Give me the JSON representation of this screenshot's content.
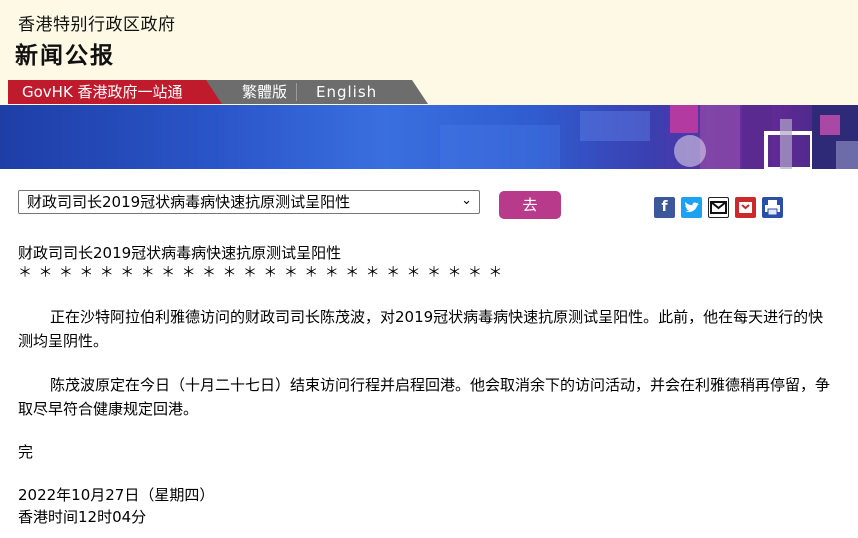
{
  "header": {
    "org": "香港特别行政区政府",
    "title": "新闻公报"
  },
  "nav": {
    "govhk": "GovHK 香港政府一站通",
    "traditional": "繁體版",
    "english": "English"
  },
  "controls": {
    "selected_news": "财政司司长2019冠状病毒病快速抗原测试呈阳性",
    "go_label": "去"
  },
  "share_icons": [
    "facebook-icon",
    "twitter-icon",
    "email-icon",
    "bookmark-icon",
    "print-icon"
  ],
  "article": {
    "title": "财政司司长2019冠状病毒病快速抗原测试呈阳性",
    "stars": "＊ ＊ ＊ ＊ ＊ ＊ ＊ ＊ ＊ ＊ ＊ ＊ ＊ ＊ ＊ ＊ ＊ ＊ ＊ ＊ ＊ ＊ ＊ ＊",
    "paragraphs": [
      "正在沙特阿拉伯利雅德访问的财政司司长陈茂波，对2019冠状病毒病快速抗原测试呈阳性。此前，他在每天进行的快测均呈阴性。",
      "陈茂波原定在今日（十月二十七日）结束访问行程并启程回港。他会取消余下的访问活动，并会在利雅德稍再停留，争取尽早符合健康规定回港。"
    ],
    "end": "完",
    "date": "2022年10月27日（星期四）",
    "time": "香港时间12时04分"
  },
  "colors": {
    "govhk_tab": "#bf1b2c",
    "lang_tab": "#6d6d6d",
    "go_button": "#b83a8a",
    "header_bg": "#fdf9e4"
  }
}
